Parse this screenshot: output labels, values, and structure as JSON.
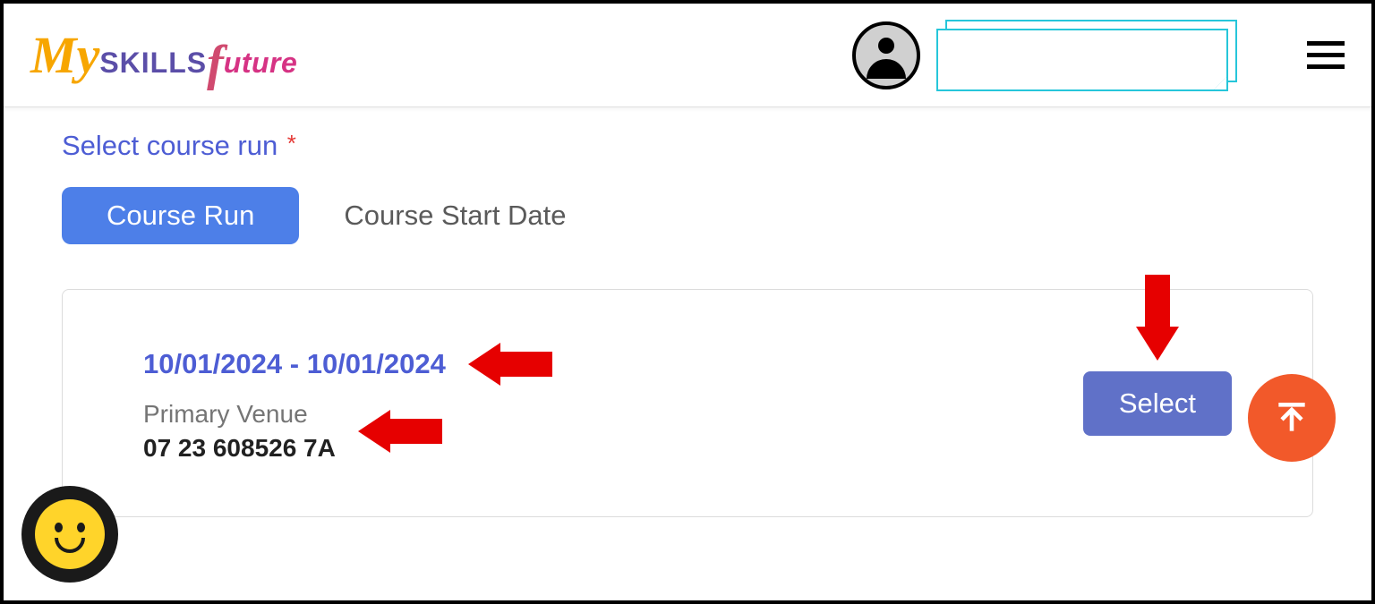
{
  "header": {
    "logo": {
      "my": "My",
      "skills": "SKILLS",
      "future_f": "f",
      "future": "uture"
    }
  },
  "content": {
    "section_title": "Select course run",
    "tabs": {
      "active": "Course Run",
      "inactive": "Course Start Date"
    },
    "card": {
      "date_range": "10/01/2024 - 10/01/2024",
      "venue_label": "Primary Venue",
      "venue_value": "07 23 608526 7A",
      "select_label": "Select"
    }
  }
}
